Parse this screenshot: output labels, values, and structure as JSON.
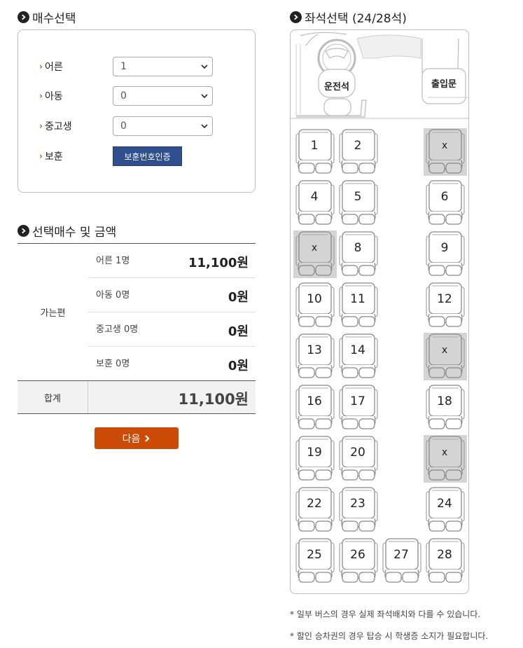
{
  "ticket_section": {
    "title": "매수선택",
    "rows": [
      {
        "label": "어른",
        "value": "1"
      },
      {
        "label": "아동",
        "value": "0"
      },
      {
        "label": "중고생",
        "value": "0"
      }
    ],
    "veteran": {
      "label": "보훈",
      "button": "보훈번호인증"
    }
  },
  "summary_section": {
    "title": "선택매수 및 금액",
    "direction_label": "가는편",
    "rows": [
      {
        "label": "어른 1명",
        "amount": "11,100원"
      },
      {
        "label": "아동 0명",
        "amount": "0원"
      },
      {
        "label": "중고생 0명",
        "amount": "0원"
      },
      {
        "label": "보훈 0명",
        "amount": "0원"
      }
    ],
    "total_label": "합계",
    "total_amount": "11,100원"
  },
  "next_button": "다음",
  "seat_section": {
    "title": "좌석선택 (24/28석)",
    "driver_label": "운전석",
    "door_label": "출입문",
    "taken_mark": "x",
    "seats": [
      {
        "label": "1",
        "taken": false
      },
      {
        "label": "2",
        "taken": false
      },
      {
        "label": "x",
        "taken": true
      },
      {
        "label": "4",
        "taken": false
      },
      {
        "label": "5",
        "taken": false
      },
      {
        "label": "6",
        "taken": false
      },
      {
        "label": "x",
        "taken": true
      },
      {
        "label": "8",
        "taken": false
      },
      {
        "label": "9",
        "taken": false
      },
      {
        "label": "10",
        "taken": false
      },
      {
        "label": "11",
        "taken": false
      },
      {
        "label": "12",
        "taken": false
      },
      {
        "label": "13",
        "taken": false
      },
      {
        "label": "14",
        "taken": false
      },
      {
        "label": "x",
        "taken": true
      },
      {
        "label": "16",
        "taken": false
      },
      {
        "label": "17",
        "taken": false
      },
      {
        "label": "18",
        "taken": false
      },
      {
        "label": "19",
        "taken": false
      },
      {
        "label": "20",
        "taken": false
      },
      {
        "label": "x",
        "taken": true
      },
      {
        "label": "22",
        "taken": false
      },
      {
        "label": "23",
        "taken": false
      },
      {
        "label": "24",
        "taken": false
      },
      {
        "label": "25",
        "taken": false
      },
      {
        "label": "26",
        "taken": false
      },
      {
        "label": "27",
        "taken": false
      },
      {
        "label": "28",
        "taken": false
      }
    ]
  },
  "notes": [
    "* 일부 버스의 경우 실제 좌석배치와 다를 수 있습니다.",
    "* 할인 승차권의 경우 탑승 시 학생증 소지가 필요합니다."
  ],
  "colors": {
    "accent": "#cc4b06",
    "verify_button": "#2f4f8f",
    "taken_seat": "#d4d4d4"
  }
}
